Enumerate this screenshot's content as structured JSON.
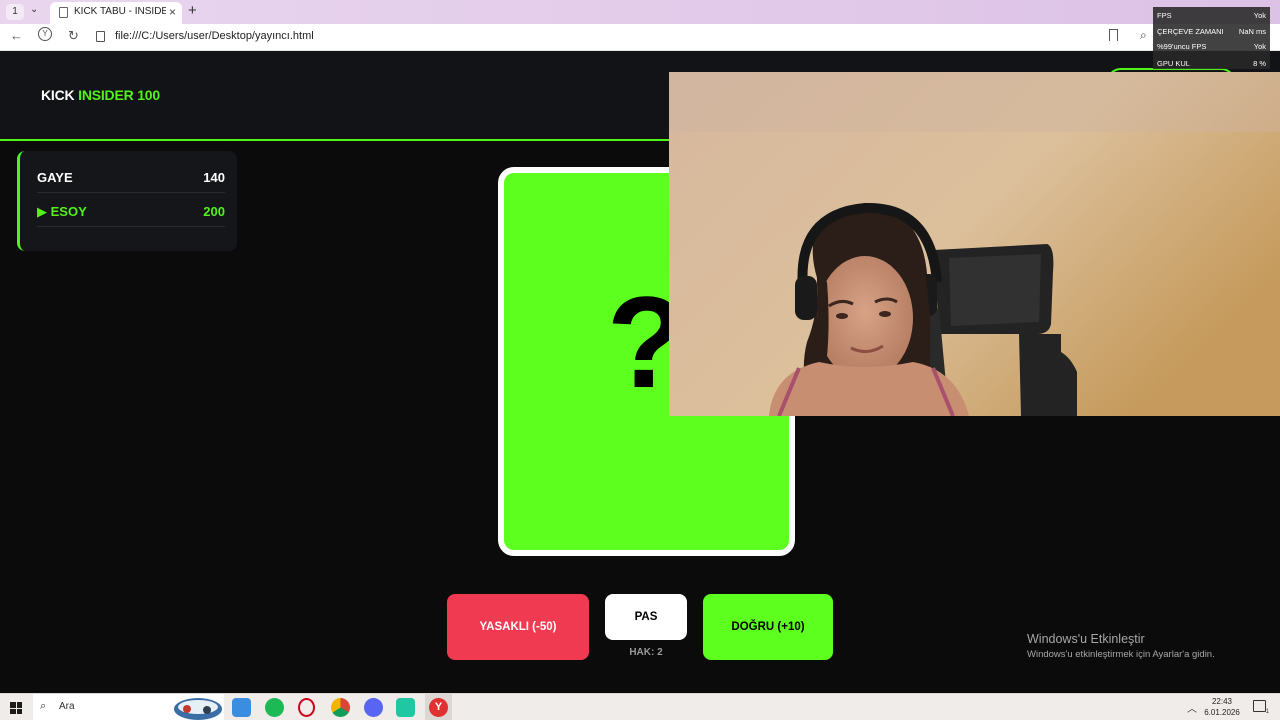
{
  "browser": {
    "tab_count": "1",
    "tab_title": "KICK TABU - INSIDER E",
    "url": "file:///C:/Users/user/Desktop/yayıncı.html"
  },
  "fps_overlay": {
    "rows": [
      {
        "label": "FPS",
        "value": "Yok"
      },
      {
        "label": "ÇERÇEVE ZAMANI",
        "value": "NaN ms"
      },
      {
        "label": "%99'uncu FPS",
        "value": "Yok"
      },
      {
        "label": "GPU KUL",
        "value": "8 %"
      }
    ]
  },
  "header": {
    "brand_prefix": "KICK",
    "brand_accent": "INSIDER 100"
  },
  "scoreboard": {
    "players": [
      {
        "name": "GAYE",
        "score": "140"
      },
      {
        "name": "▶ ESOY",
        "score": "200"
      }
    ]
  },
  "card": {
    "symbol": "?"
  },
  "controls": {
    "forbidden_label": "YASAKLI (-50)",
    "pass_label": "PAS",
    "pass_remaining": "HAK: 2",
    "correct_label": "DOĞRU (+10)"
  },
  "windows_activation": {
    "title": "Windows'u Etkinleştir",
    "subtitle": "Windows'u etkinleştirmek için Ayarlar'a gidin."
  },
  "taskbar": {
    "search_placeholder": "Ara",
    "time": "22:43",
    "date": "6.01.2026",
    "notification_count": "1"
  },
  "colors": {
    "accent": "#52f21b",
    "card": "#5cff1e",
    "danger": "#ef3a51",
    "background": "#0b0b0c"
  }
}
